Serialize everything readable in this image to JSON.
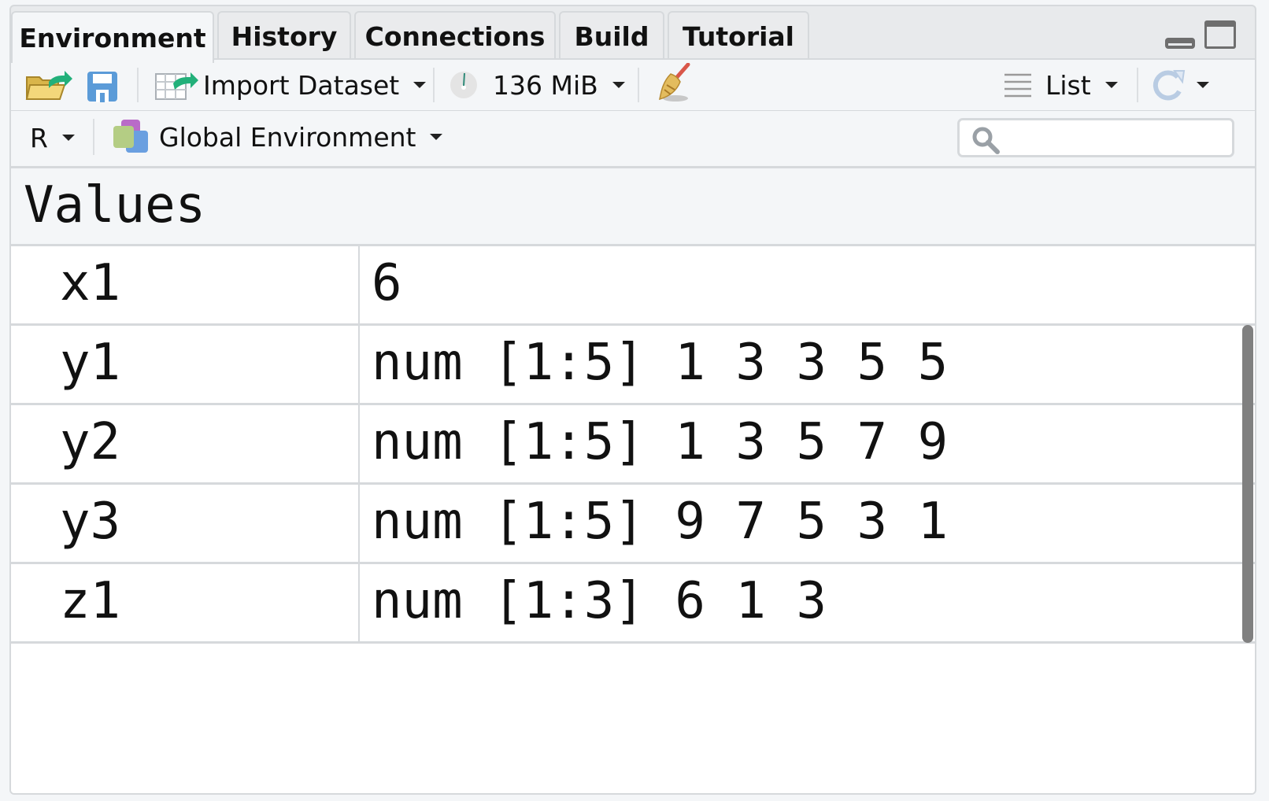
{
  "tabs": [
    {
      "label": "Environment",
      "active": true
    },
    {
      "label": "History",
      "active": false
    },
    {
      "label": "Connections",
      "active": false
    },
    {
      "label": "Build",
      "active": false
    },
    {
      "label": "Tutorial",
      "active": false
    }
  ],
  "toolbar": {
    "import_dataset_label": "Import Dataset",
    "memory_label": "136 MiB",
    "view_mode_label": "List"
  },
  "envbar": {
    "language_label": "R",
    "environment_label": "Global Environment",
    "search_placeholder": ""
  },
  "section_title": "Values",
  "rows": [
    {
      "name": "x1",
      "value": "6"
    },
    {
      "name": "y1",
      "value": "num [1:5] 1 3 3 5 5"
    },
    {
      "name": "y2",
      "value": "num [1:5] 1 3 5 7 9"
    },
    {
      "name": "y3",
      "value": "num [1:5] 9 7 5 3 1"
    },
    {
      "name": "z1",
      "value": "num [1:3] 6 1 3"
    }
  ]
}
